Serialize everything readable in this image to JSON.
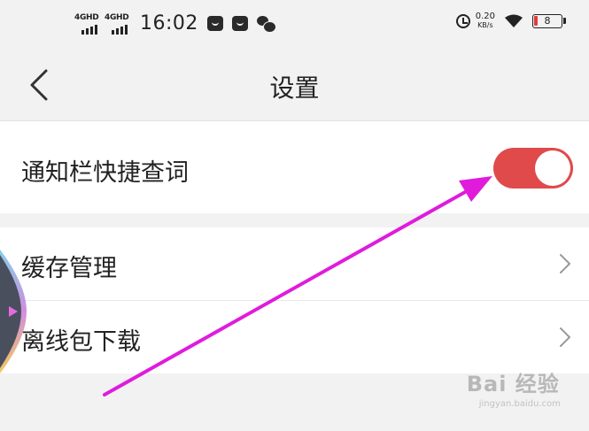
{
  "status_bar": {
    "signal1_label": "4GHD",
    "signal2_label": "4GHD",
    "time": "16:02",
    "speed_value": "0.20",
    "speed_unit": "KB/s",
    "battery_level": "8"
  },
  "header": {
    "title": "设置"
  },
  "settings": {
    "notification_quick_lookup": {
      "label": "通知栏快捷查词",
      "enabled": true
    },
    "cache_management": {
      "label": "缓存管理"
    },
    "offline_package_download": {
      "label": "离线包下载"
    }
  },
  "watermark": {
    "main": "Bai 经验",
    "sub": "jingyan.baidu.com"
  },
  "colors": {
    "toggle_on": "#e04a4a",
    "annotation_arrow": "#e01bdc"
  }
}
